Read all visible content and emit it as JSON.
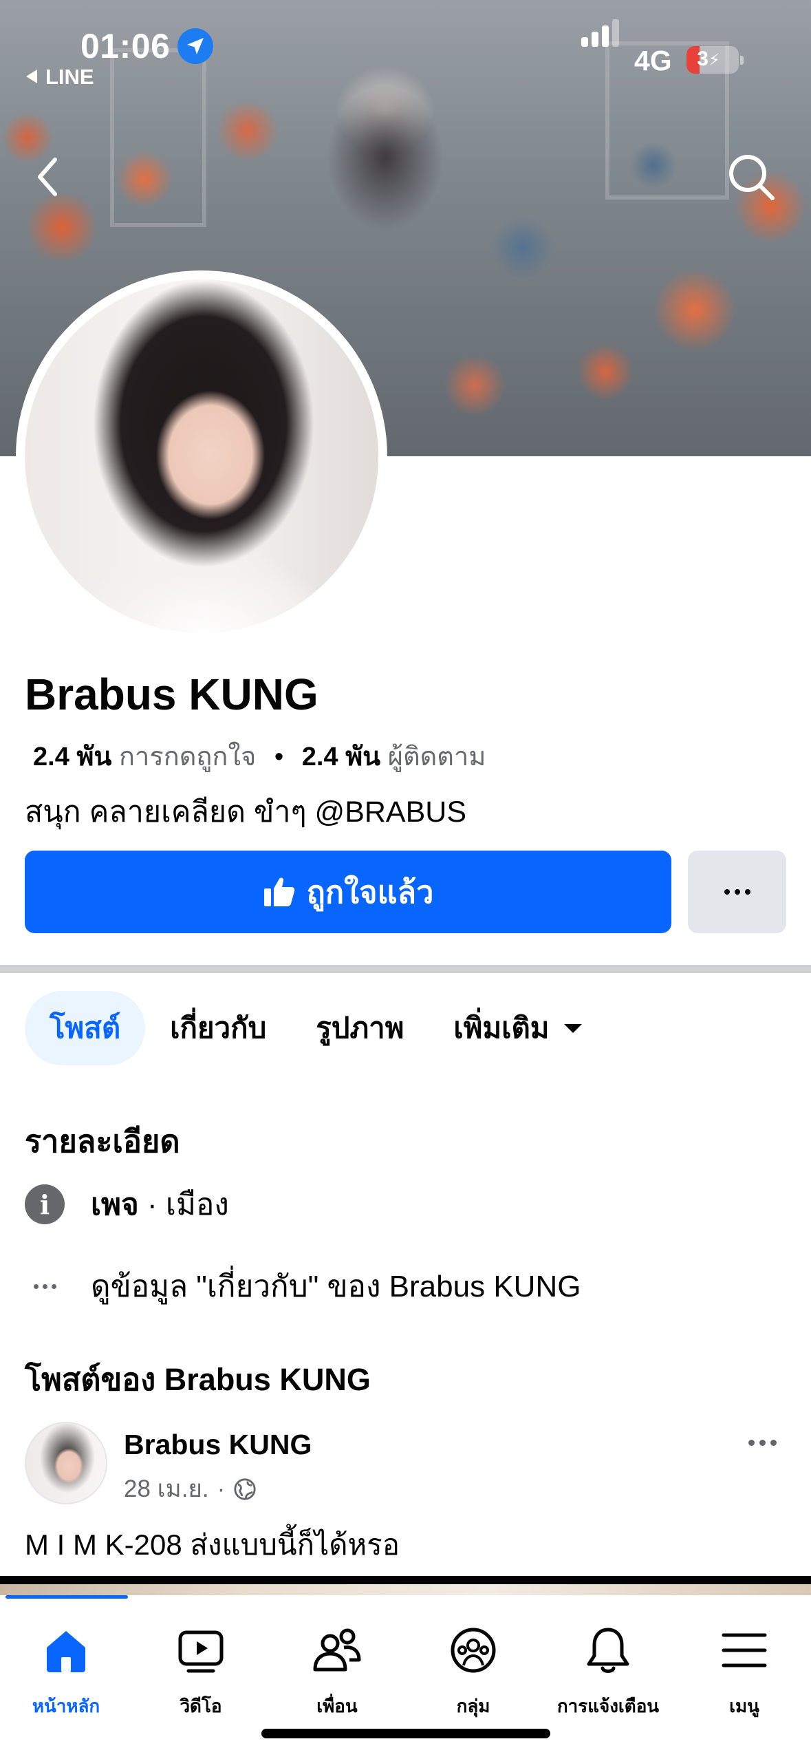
{
  "status_bar": {
    "time": "01:06",
    "back_app": "LINE",
    "network": "4G",
    "battery_level": "3",
    "battery_percent": 3
  },
  "colors": {
    "accent": "#0866ff",
    "button_secondary": "#e4e6eb",
    "text_secondary": "#65676b",
    "tab_active_bg": "#ebf5ff",
    "battery_low": "#e8413a"
  },
  "profile": {
    "name": "Brabus KUNG",
    "likes_count": "2.4 พัน",
    "likes_label": "การกดถูกใจ",
    "followers_count": "2.4 พัน",
    "followers_label": "ผู้ติดตาม",
    "bio": "สนุก คลายเคลียด ขำๆ @BRABUS",
    "like_button_label": "ถูกใจแล้ว"
  },
  "tabs": [
    {
      "label": "โพสต์",
      "active": true
    },
    {
      "label": "เกี่ยวกับ",
      "active": false
    },
    {
      "label": "รูปภาพ",
      "active": false
    },
    {
      "label": "เพิ่มเติม",
      "active": false
    }
  ],
  "details": {
    "title": "รายละเอียด",
    "category_bold": "เพจ",
    "category_rest": " · เมือง",
    "about_link": "ดูข้อมูล \"เกี่ยวกับ\" ของ Brabus KUNG"
  },
  "posts_section": {
    "title": "โพสต์ของ Brabus KUNG",
    "post": {
      "author": "Brabus KUNG",
      "date": "28 เม.ย.",
      "separator": "·",
      "privacy_icon": "globe-icon",
      "text": "M I M K-208 ส่งแบบนี้ก็ได้หรอ"
    }
  },
  "bottom_nav": [
    {
      "label": "หน้าหลัก",
      "icon": "home-icon",
      "active": true
    },
    {
      "label": "วิดีโอ",
      "icon": "video-icon",
      "active": false
    },
    {
      "label": "เพื่อน",
      "icon": "friends-icon",
      "active": false
    },
    {
      "label": "กลุ่ม",
      "icon": "groups-icon",
      "active": false
    },
    {
      "label": "การแจ้งเตือน",
      "icon": "bell-icon",
      "active": false
    },
    {
      "label": "เมนู",
      "icon": "menu-icon",
      "active": false
    }
  ]
}
